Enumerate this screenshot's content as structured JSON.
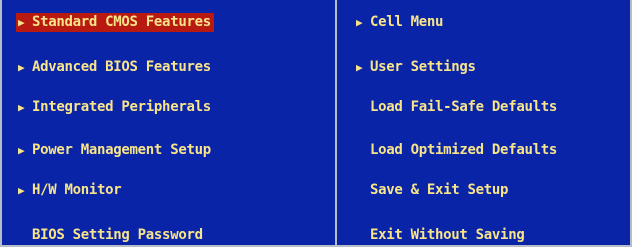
{
  "left_menu": [
    {
      "label": "Standard CMOS Features",
      "arrow": "▶"
    },
    {
      "label": "Advanced BIOS Features",
      "arrow": "▶"
    },
    {
      "label": "Integrated Peripherals",
      "arrow": "▶"
    },
    {
      "label": "Power Management Setup",
      "arrow": "▶"
    },
    {
      "label": "H/W Monitor",
      "arrow": "▶"
    },
    {
      "label": "BIOS Setting Password"
    }
  ],
  "right_menu": [
    {
      "label": "Cell Menu",
      "arrow": "▶"
    },
    {
      "label": "User Settings",
      "arrow": "▶"
    },
    {
      "label": "Load Fail-Safe Defaults"
    },
    {
      "label": "Load Optimized Defaults"
    },
    {
      "label": "Save & Exit Setup"
    },
    {
      "label": "Exit Without Saving"
    }
  ],
  "selected_item": "Standard CMOS Features",
  "colors": {
    "background": "#0a24a8",
    "text": "#f8e58a",
    "highlight": "#b81a12",
    "frame": "#b8bcc8"
  }
}
